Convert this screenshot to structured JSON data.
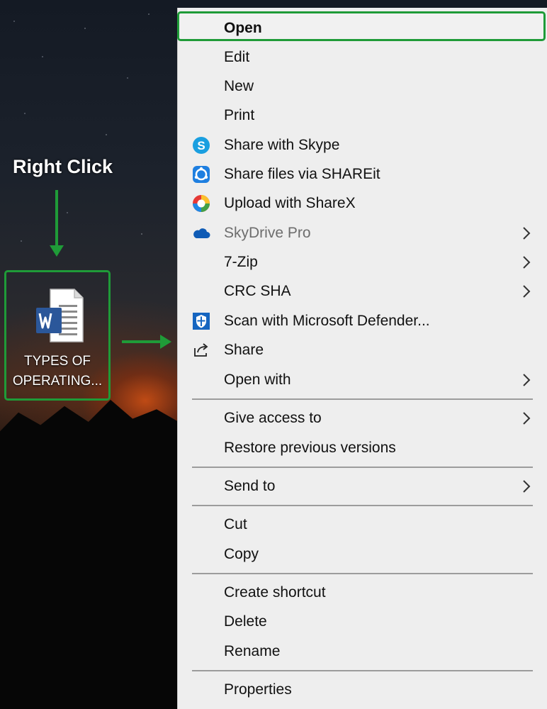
{
  "annotation": {
    "label": "Right Click"
  },
  "desktop_file": {
    "name_line1": "TYPES OF",
    "name_line2": "OPERATING..."
  },
  "menu": {
    "items": [
      {
        "label": "Open",
        "icon": "",
        "submenu": false
      },
      {
        "label": "Edit",
        "icon": "",
        "submenu": false
      },
      {
        "label": "New",
        "icon": "",
        "submenu": false
      },
      {
        "label": "Print",
        "icon": "",
        "submenu": false
      },
      {
        "label": "Share with Skype",
        "icon": "skype-icon",
        "submenu": false
      },
      {
        "label": "Share files via SHAREit",
        "icon": "shareit-icon",
        "submenu": false
      },
      {
        "label": "Upload with ShareX",
        "icon": "sharex-icon",
        "submenu": false
      },
      {
        "label": "SkyDrive Pro",
        "icon": "cloud-icon",
        "submenu": true
      },
      {
        "label": "7-Zip",
        "icon": "",
        "submenu": true
      },
      {
        "label": "CRC SHA",
        "icon": "",
        "submenu": true
      },
      {
        "label": "Scan with Microsoft Defender...",
        "icon": "defender-shield-icon",
        "submenu": false
      },
      {
        "label": "Share",
        "icon": "share-icon",
        "submenu": false
      },
      {
        "label": "Open with",
        "icon": "",
        "submenu": true
      },
      {
        "label": "Give access to",
        "icon": "",
        "submenu": true
      },
      {
        "label": "Restore previous versions",
        "icon": "",
        "submenu": false
      },
      {
        "label": "Send to",
        "icon": "",
        "submenu": true
      },
      {
        "label": "Cut",
        "icon": "",
        "submenu": false
      },
      {
        "label": "Copy",
        "icon": "",
        "submenu": false
      },
      {
        "label": "Create shortcut",
        "icon": "",
        "submenu": false
      },
      {
        "label": "Delete",
        "icon": "",
        "submenu": false
      },
      {
        "label": "Rename",
        "icon": "",
        "submenu": false
      },
      {
        "label": "Properties",
        "icon": "",
        "submenu": false
      }
    ]
  },
  "colors": {
    "highlight": "#1f9b38",
    "menu_bg": "#eeeeee",
    "disabled_text": "#6d6d6d"
  }
}
